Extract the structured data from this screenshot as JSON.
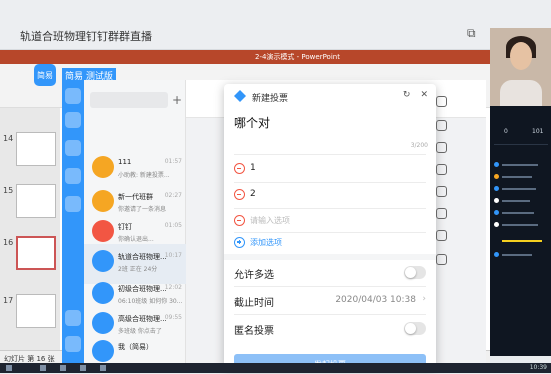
{
  "window": {
    "title": "轨道合班物理钉钉群群直播"
  },
  "app_label": {
    "logo": "简易",
    "name": "简易 测试版"
  },
  "dialog": {
    "title": "新建投票",
    "question": "哪个对",
    "counter": "3/200",
    "options": [
      "1",
      "2"
    ],
    "option_placeholder": "请输入选项",
    "add_option_label": "添加选项",
    "allow_multiple_label": "允许多选",
    "deadline_label": "截止时间",
    "deadline_value": "2020/04/03 10:38",
    "anonymous_label": "匿名投票",
    "create_label": "发起投票"
  },
  "chat_list": [
    {
      "name": "111",
      "sub": "小助教: 新建投票...",
      "time": "01:57",
      "color": "#f5a623"
    },
    {
      "name": "新一代班群",
      "sub": "你邀请了一条消息",
      "time": "02:27",
      "color": "#f5a623"
    },
    {
      "name": "钉钉",
      "sub": "你确认退出...",
      "time": "01:05",
      "color": "#f25643"
    },
    {
      "name": "轨道合班物理...",
      "sub": "2班 正在 24分",
      "time": "10:17",
      "color": "#3296fa"
    },
    {
      "name": "初级合班物理...",
      "sub": "06:10班级 如何你 30...",
      "time": "12:02",
      "color": "#3296fa"
    },
    {
      "name": "高级合班物理...",
      "sub": "多班级 你点击了",
      "time": "09:55",
      "color": "#3296fa"
    },
    {
      "name": "我（简易）",
      "sub": "",
      "time": "",
      "color": "#3296fa"
    }
  ],
  "slides": [
    "14",
    "15",
    "16",
    "17"
  ],
  "ppt": {
    "title_text": "2-4演示模式 - PowerPoint",
    "status": "幻灯片 第 16 张"
  },
  "taskbar": {
    "time": "10:39"
  },
  "stream_panel": {
    "stat1": "0",
    "stat2": "101"
  }
}
